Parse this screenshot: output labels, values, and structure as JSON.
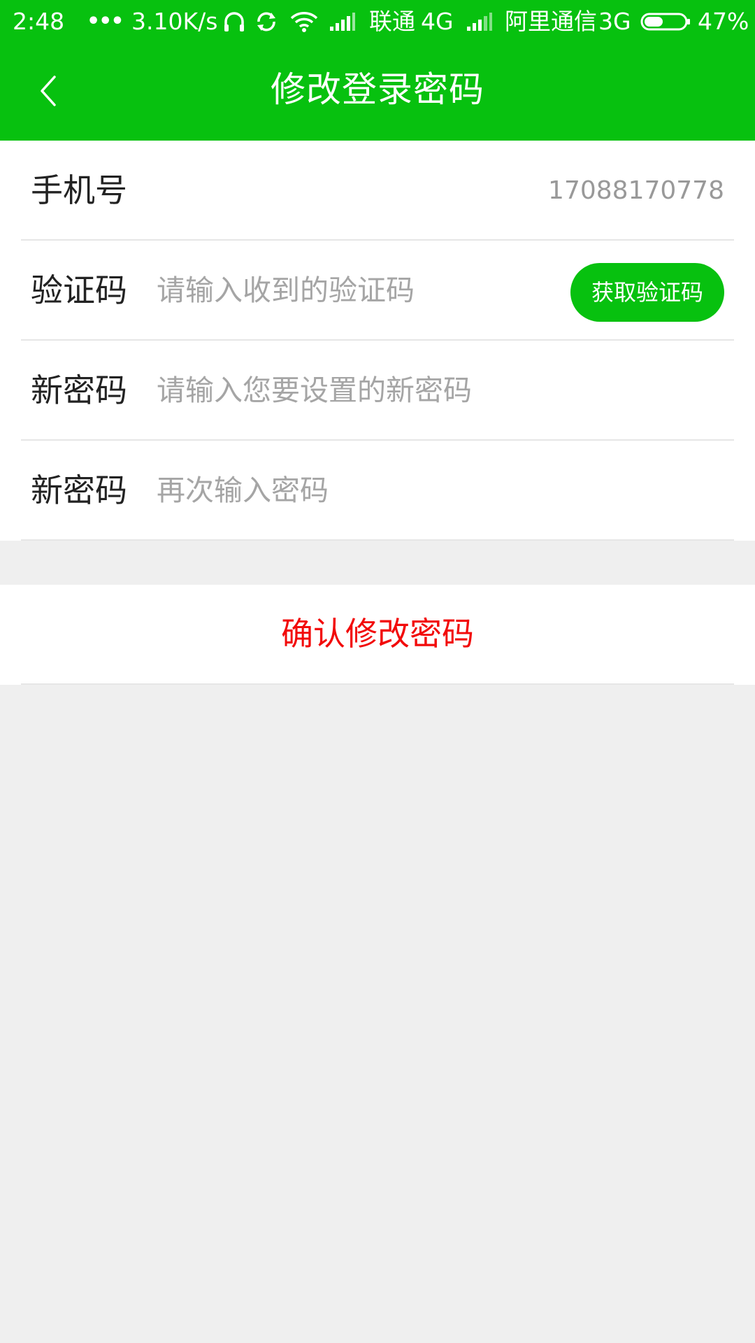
{
  "status_bar": {
    "time": "2:48",
    "more": "•••",
    "net_speed": "3.10K/s",
    "carrier1": "联通",
    "net1": "4G",
    "carrier2": "阿里通信",
    "net2": "3G",
    "battery": "47%",
    "battery_level": 0.47,
    "icons": [
      "headphones-icon",
      "sync-icon",
      "wifi-icon",
      "signal-icon",
      "signal-icon",
      "battery-icon"
    ]
  },
  "nav": {
    "title": "修改登录密码",
    "back_icon": "chevron-left-icon"
  },
  "form": {
    "phone": {
      "label": "手机号",
      "value": "17088170778"
    },
    "code": {
      "label": "验证码",
      "placeholder": "请输入收到的验证码",
      "button": "获取验证码"
    },
    "new_password": {
      "label": "新密码",
      "placeholder": "请输入您要设置的新密码"
    },
    "confirm_password": {
      "label": "新密码",
      "placeholder": "再次输入密码"
    }
  },
  "confirm_button": "确认修改密码",
  "colors": {
    "brand_green": "#07c10f",
    "confirm_red": "#f20a0a",
    "background": "#efefef"
  }
}
